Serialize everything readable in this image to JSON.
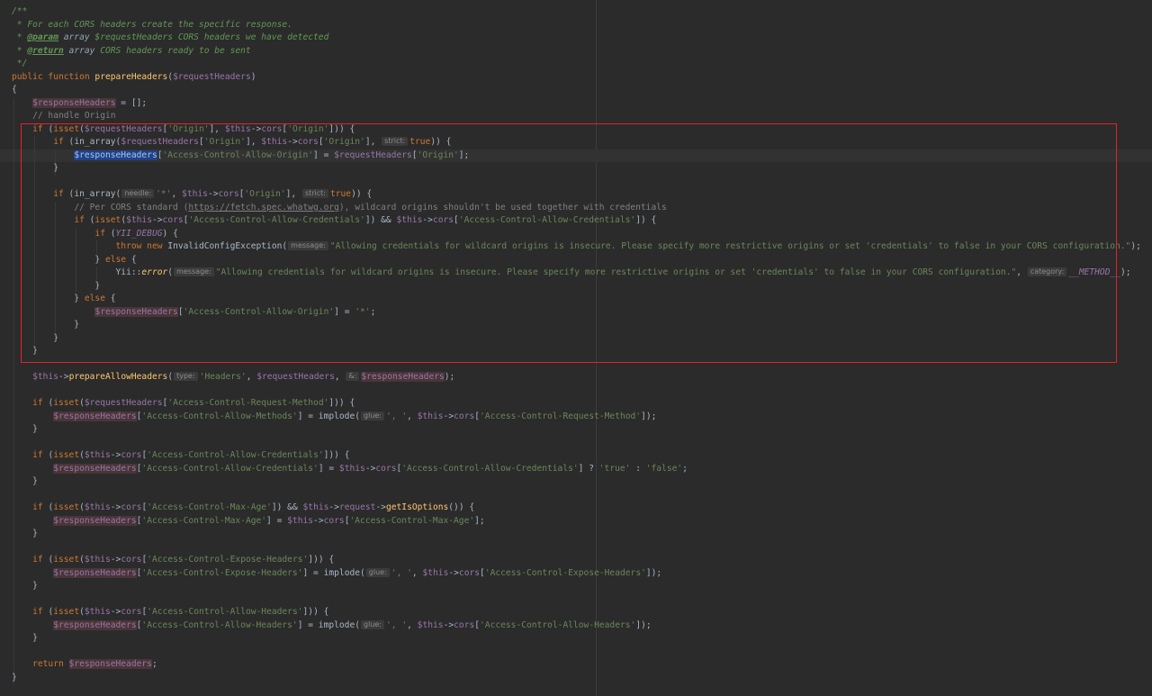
{
  "editor": {
    "current_line": 11,
    "selection_line_range": [
      9,
      26
    ],
    "lines": [
      [
        [
          "c-doc",
          "/**"
        ]
      ],
      [
        [
          "c-doc",
          " * For each CORS headers create the specific response."
        ]
      ],
      [
        [
          "c-doc",
          " * "
        ],
        [
          "c-doctag",
          "@param"
        ],
        [
          "c-doctype",
          " array "
        ],
        [
          "c-doc",
          "$requestHeaders CORS headers we have detected"
        ]
      ],
      [
        [
          "c-doc",
          " * "
        ],
        [
          "c-doctag",
          "@return"
        ],
        [
          "c-doctype",
          " array "
        ],
        [
          "c-doc",
          "CORS headers ready to be sent"
        ]
      ],
      [
        [
          "c-doc",
          " */"
        ]
      ],
      [
        [
          "c-kw",
          "public function "
        ],
        [
          "c-fn",
          "prepareHeaders"
        ],
        [
          "c-plain",
          "("
        ],
        [
          "c-var",
          "$requestHeaders"
        ],
        [
          "c-plain",
          ")"
        ]
      ],
      [
        [
          "c-plain",
          "{"
        ]
      ],
      [
        [
          "c-plain",
          "    "
        ],
        [
          "c-var-hl",
          "$responseHeaders"
        ],
        [
          "c-plain",
          " = [];"
        ]
      ],
      [
        [
          "c-plain",
          "    "
        ],
        [
          "c-cmt",
          "// handle Origin"
        ]
      ],
      [
        [
          "c-plain",
          "    "
        ],
        [
          "c-kw",
          "if "
        ],
        [
          "c-plain",
          "("
        ],
        [
          "c-kw",
          "isset"
        ],
        [
          "c-plain",
          "("
        ],
        [
          "c-var",
          "$requestHeaders"
        ],
        [
          "c-plain",
          "["
        ],
        [
          "c-str",
          "'Origin'"
        ],
        [
          "c-plain",
          "], "
        ],
        [
          "c-var",
          "$this"
        ],
        [
          "c-plain",
          "->"
        ],
        [
          "c-var",
          "cors"
        ],
        [
          "c-plain",
          "["
        ],
        [
          "c-str",
          "'Origin'"
        ],
        [
          "c-plain",
          "])) {"
        ]
      ],
      [
        [
          "c-plain",
          "        "
        ],
        [
          "c-kw",
          "if "
        ],
        [
          "c-plain",
          "(in_array("
        ],
        [
          "c-var",
          "$requestHeaders"
        ],
        [
          "c-plain",
          "["
        ],
        [
          "c-str",
          "'Origin'"
        ],
        [
          "c-plain",
          "], "
        ],
        [
          "c-var",
          "$this"
        ],
        [
          "c-plain",
          "->"
        ],
        [
          "c-var",
          "cors"
        ],
        [
          "c-plain",
          "["
        ],
        [
          "c-str",
          "'Origin'"
        ],
        [
          "c-plain",
          "], "
        ],
        [
          "hint",
          "strict:"
        ],
        [
          "c-kw",
          "true"
        ],
        [
          "c-plain",
          ")) {"
        ]
      ],
      [
        [
          "c-plain",
          "            "
        ],
        [
          "c-var-sel",
          "$responseHeaders"
        ],
        [
          "c-plain",
          "["
        ],
        [
          "c-str",
          "'Access-Control-Allow-Origin'"
        ],
        [
          "c-plain",
          "] = "
        ],
        [
          "c-var",
          "$requestHeaders"
        ],
        [
          "c-plain",
          "["
        ],
        [
          "c-str",
          "'Origin'"
        ],
        [
          "c-plain",
          "];"
        ]
      ],
      [
        [
          "c-plain",
          "        }"
        ]
      ],
      [],
      [
        [
          "c-plain",
          "        "
        ],
        [
          "c-kw",
          "if "
        ],
        [
          "c-plain",
          "(in_array("
        ],
        [
          "hint",
          "needle:"
        ],
        [
          "c-str",
          "'*'"
        ],
        [
          "c-plain",
          ", "
        ],
        [
          "c-var",
          "$this"
        ],
        [
          "c-plain",
          "->"
        ],
        [
          "c-var",
          "cors"
        ],
        [
          "c-plain",
          "["
        ],
        [
          "c-str",
          "'Origin'"
        ],
        [
          "c-plain",
          "], "
        ],
        [
          "hint",
          "strict:"
        ],
        [
          "c-kw",
          "true"
        ],
        [
          "c-plain",
          ")) {"
        ]
      ],
      [
        [
          "c-plain",
          "            "
        ],
        [
          "c-cmt",
          "// Per CORS standard ("
        ],
        [
          "c-url",
          "https://fetch.spec.whatwg.org"
        ],
        [
          "c-cmt",
          "), wildcard origins shouldn't be used together with credentials"
        ]
      ],
      [
        [
          "c-plain",
          "            "
        ],
        [
          "c-kw",
          "if "
        ],
        [
          "c-plain",
          "("
        ],
        [
          "c-kw",
          "isset"
        ],
        [
          "c-plain",
          "("
        ],
        [
          "c-var",
          "$this"
        ],
        [
          "c-plain",
          "->"
        ],
        [
          "c-var",
          "cors"
        ],
        [
          "c-plain",
          "["
        ],
        [
          "c-str",
          "'Access-Control-Allow-Credentials'"
        ],
        [
          "c-plain",
          "]) && "
        ],
        [
          "c-var",
          "$this"
        ],
        [
          "c-plain",
          "->"
        ],
        [
          "c-var",
          "cors"
        ],
        [
          "c-plain",
          "["
        ],
        [
          "c-str",
          "'Access-Control-Allow-Credentials'"
        ],
        [
          "c-plain",
          "]) {"
        ]
      ],
      [
        [
          "c-plain",
          "                "
        ],
        [
          "c-kw",
          "if "
        ],
        [
          "c-plain",
          "("
        ],
        [
          "c-const",
          "YII_DEBUG"
        ],
        [
          "c-plain",
          ") {"
        ]
      ],
      [
        [
          "c-plain",
          "                    "
        ],
        [
          "c-kw",
          "throw new "
        ],
        [
          "c-plain",
          "InvalidConfigException("
        ],
        [
          "hint",
          "message:"
        ],
        [
          "c-str",
          "\"Allowing credentials for wildcard origins is insecure. Please specify more restrictive origins or set 'credentials' to false in your CORS configuration.\""
        ],
        [
          "c-plain",
          ");"
        ]
      ],
      [
        [
          "c-plain",
          "                } "
        ],
        [
          "c-kw",
          "else "
        ],
        [
          "c-plain",
          "{"
        ]
      ],
      [
        [
          "c-plain",
          "                    Yii::"
        ],
        [
          "c-method-it",
          "error"
        ],
        [
          "c-plain",
          "("
        ],
        [
          "hint",
          "message:"
        ],
        [
          "c-str",
          "\"Allowing credentials for wildcard origins is insecure. Please specify more restrictive origins or set 'credentials' to false in your CORS configuration.\""
        ],
        [
          "c-plain",
          ", "
        ],
        [
          "hint",
          "category:"
        ],
        [
          "c-const",
          "__METHOD__"
        ],
        [
          "c-plain",
          ");"
        ]
      ],
      [
        [
          "c-plain",
          "                }"
        ]
      ],
      [
        [
          "c-plain",
          "            } "
        ],
        [
          "c-kw",
          "else "
        ],
        [
          "c-plain",
          "{"
        ]
      ],
      [
        [
          "c-plain",
          "                "
        ],
        [
          "c-var-hl",
          "$responseHeaders"
        ],
        [
          "c-plain",
          "["
        ],
        [
          "c-str",
          "'Access-Control-Allow-Origin'"
        ],
        [
          "c-plain",
          "] = "
        ],
        [
          "c-str",
          "'*'"
        ],
        [
          "c-plain",
          ";"
        ]
      ],
      [
        [
          "c-plain",
          "            }"
        ]
      ],
      [
        [
          "c-plain",
          "        }"
        ]
      ],
      [
        [
          "c-plain",
          "    }"
        ]
      ],
      [],
      [
        [
          "c-plain",
          "    "
        ],
        [
          "c-var",
          "$this"
        ],
        [
          "c-plain",
          "->"
        ],
        [
          "c-fn",
          "prepareAllowHeaders"
        ],
        [
          "c-plain",
          "("
        ],
        [
          "hint",
          "type:"
        ],
        [
          "c-str",
          "'Headers'"
        ],
        [
          "c-plain",
          ", "
        ],
        [
          "c-var",
          "$requestHeaders"
        ],
        [
          "c-plain",
          ", "
        ],
        [
          "hint",
          "&:"
        ],
        [
          "c-var-hl",
          "$responseHeaders"
        ],
        [
          "c-plain",
          ");"
        ]
      ],
      [],
      [
        [
          "c-plain",
          "    "
        ],
        [
          "c-kw",
          "if "
        ],
        [
          "c-plain",
          "("
        ],
        [
          "c-kw",
          "isset"
        ],
        [
          "c-plain",
          "("
        ],
        [
          "c-var",
          "$requestHeaders"
        ],
        [
          "c-plain",
          "["
        ],
        [
          "c-str",
          "'Access-Control-Request-Method'"
        ],
        [
          "c-plain",
          "])) {"
        ]
      ],
      [
        [
          "c-plain",
          "        "
        ],
        [
          "c-var-hl",
          "$responseHeaders"
        ],
        [
          "c-plain",
          "["
        ],
        [
          "c-str",
          "'Access-Control-Allow-Methods'"
        ],
        [
          "c-plain",
          "] = implode("
        ],
        [
          "hint",
          "glue:"
        ],
        [
          "c-str",
          "', '"
        ],
        [
          "c-plain",
          ", "
        ],
        [
          "c-var",
          "$this"
        ],
        [
          "c-plain",
          "->"
        ],
        [
          "c-var",
          "cors"
        ],
        [
          "c-plain",
          "["
        ],
        [
          "c-str",
          "'Access-Control-Request-Method'"
        ],
        [
          "c-plain",
          "]);"
        ]
      ],
      [
        [
          "c-plain",
          "    }"
        ]
      ],
      [],
      [
        [
          "c-plain",
          "    "
        ],
        [
          "c-kw",
          "if "
        ],
        [
          "c-plain",
          "("
        ],
        [
          "c-kw",
          "isset"
        ],
        [
          "c-plain",
          "("
        ],
        [
          "c-var",
          "$this"
        ],
        [
          "c-plain",
          "->"
        ],
        [
          "c-var",
          "cors"
        ],
        [
          "c-plain",
          "["
        ],
        [
          "c-str",
          "'Access-Control-Allow-Credentials'"
        ],
        [
          "c-plain",
          "])) {"
        ]
      ],
      [
        [
          "c-plain",
          "        "
        ],
        [
          "c-var-hl",
          "$responseHeaders"
        ],
        [
          "c-plain",
          "["
        ],
        [
          "c-str",
          "'Access-Control-Allow-Credentials'"
        ],
        [
          "c-plain",
          "] = "
        ],
        [
          "c-var",
          "$this"
        ],
        [
          "c-plain",
          "->"
        ],
        [
          "c-var",
          "cors"
        ],
        [
          "c-plain",
          "["
        ],
        [
          "c-str",
          "'Access-Control-Allow-Credentials'"
        ],
        [
          "c-plain",
          "] ? "
        ],
        [
          "c-str",
          "'true'"
        ],
        [
          "c-plain",
          " : "
        ],
        [
          "c-str",
          "'false'"
        ],
        [
          "c-plain",
          ";"
        ]
      ],
      [
        [
          "c-plain",
          "    }"
        ]
      ],
      [],
      [
        [
          "c-plain",
          "    "
        ],
        [
          "c-kw",
          "if "
        ],
        [
          "c-plain",
          "("
        ],
        [
          "c-kw",
          "isset"
        ],
        [
          "c-plain",
          "("
        ],
        [
          "c-var",
          "$this"
        ],
        [
          "c-plain",
          "->"
        ],
        [
          "c-var",
          "cors"
        ],
        [
          "c-plain",
          "["
        ],
        [
          "c-str",
          "'Access-Control-Max-Age'"
        ],
        [
          "c-plain",
          "]) && "
        ],
        [
          "c-var",
          "$this"
        ],
        [
          "c-plain",
          "->"
        ],
        [
          "c-var",
          "request"
        ],
        [
          "c-plain",
          "->"
        ],
        [
          "c-fn",
          "getIsOptions"
        ],
        [
          "c-plain",
          "()) {"
        ]
      ],
      [
        [
          "c-plain",
          "        "
        ],
        [
          "c-var-hl",
          "$responseHeaders"
        ],
        [
          "c-plain",
          "["
        ],
        [
          "c-str",
          "'Access-Control-Max-Age'"
        ],
        [
          "c-plain",
          "] = "
        ],
        [
          "c-var",
          "$this"
        ],
        [
          "c-plain",
          "->"
        ],
        [
          "c-var",
          "cors"
        ],
        [
          "c-plain",
          "["
        ],
        [
          "c-str",
          "'Access-Control-Max-Age'"
        ],
        [
          "c-plain",
          "];"
        ]
      ],
      [
        [
          "c-plain",
          "    }"
        ]
      ],
      [],
      [
        [
          "c-plain",
          "    "
        ],
        [
          "c-kw",
          "if "
        ],
        [
          "c-plain",
          "("
        ],
        [
          "c-kw",
          "isset"
        ],
        [
          "c-plain",
          "("
        ],
        [
          "c-var",
          "$this"
        ],
        [
          "c-plain",
          "->"
        ],
        [
          "c-var",
          "cors"
        ],
        [
          "c-plain",
          "["
        ],
        [
          "c-str",
          "'Access-Control-Expose-Headers'"
        ],
        [
          "c-plain",
          "])) {"
        ]
      ],
      [
        [
          "c-plain",
          "        "
        ],
        [
          "c-var-hl",
          "$responseHeaders"
        ],
        [
          "c-plain",
          "["
        ],
        [
          "c-str",
          "'Access-Control-Expose-Headers'"
        ],
        [
          "c-plain",
          "] = implode("
        ],
        [
          "hint",
          "glue:"
        ],
        [
          "c-str",
          "', '"
        ],
        [
          "c-plain",
          ", "
        ],
        [
          "c-var",
          "$this"
        ],
        [
          "c-plain",
          "->"
        ],
        [
          "c-var",
          "cors"
        ],
        [
          "c-plain",
          "["
        ],
        [
          "c-str",
          "'Access-Control-Expose-Headers'"
        ],
        [
          "c-plain",
          "]);"
        ]
      ],
      [
        [
          "c-plain",
          "    }"
        ]
      ],
      [],
      [
        [
          "c-plain",
          "    "
        ],
        [
          "c-kw",
          "if "
        ],
        [
          "c-plain",
          "("
        ],
        [
          "c-kw",
          "isset"
        ],
        [
          "c-plain",
          "("
        ],
        [
          "c-var",
          "$this"
        ],
        [
          "c-plain",
          "->"
        ],
        [
          "c-var",
          "cors"
        ],
        [
          "c-plain",
          "["
        ],
        [
          "c-str",
          "'Access-Control-Allow-Headers'"
        ],
        [
          "c-plain",
          "])) {"
        ]
      ],
      [
        [
          "c-plain",
          "        "
        ],
        [
          "c-var-hl",
          "$responseHeaders"
        ],
        [
          "c-plain",
          "["
        ],
        [
          "c-str",
          "'Access-Control-Allow-Headers'"
        ],
        [
          "c-plain",
          "] = implode("
        ],
        [
          "hint",
          "glue:"
        ],
        [
          "c-str",
          "', '"
        ],
        [
          "c-plain",
          ", "
        ],
        [
          "c-var",
          "$this"
        ],
        [
          "c-plain",
          "->"
        ],
        [
          "c-var",
          "cors"
        ],
        [
          "c-plain",
          "["
        ],
        [
          "c-str",
          "'Access-Control-Allow-Headers'"
        ],
        [
          "c-plain",
          "]);"
        ]
      ],
      [
        [
          "c-plain",
          "    }"
        ]
      ],
      [],
      [
        [
          "c-plain",
          "    "
        ],
        [
          "c-kw",
          "return "
        ],
        [
          "c-var-hl",
          "$responseHeaders"
        ],
        [
          "c-plain",
          ";"
        ]
      ],
      [
        [
          "c-plain",
          "}"
        ]
      ]
    ]
  },
  "colors": {
    "background": "#2b2b2b",
    "keyword": "#cc7832",
    "function": "#ffc66d",
    "variable": "#9876aa",
    "string": "#6a8759",
    "comment": "#808080",
    "doc_comment": "#629755",
    "selection_box": "#e0242a"
  }
}
